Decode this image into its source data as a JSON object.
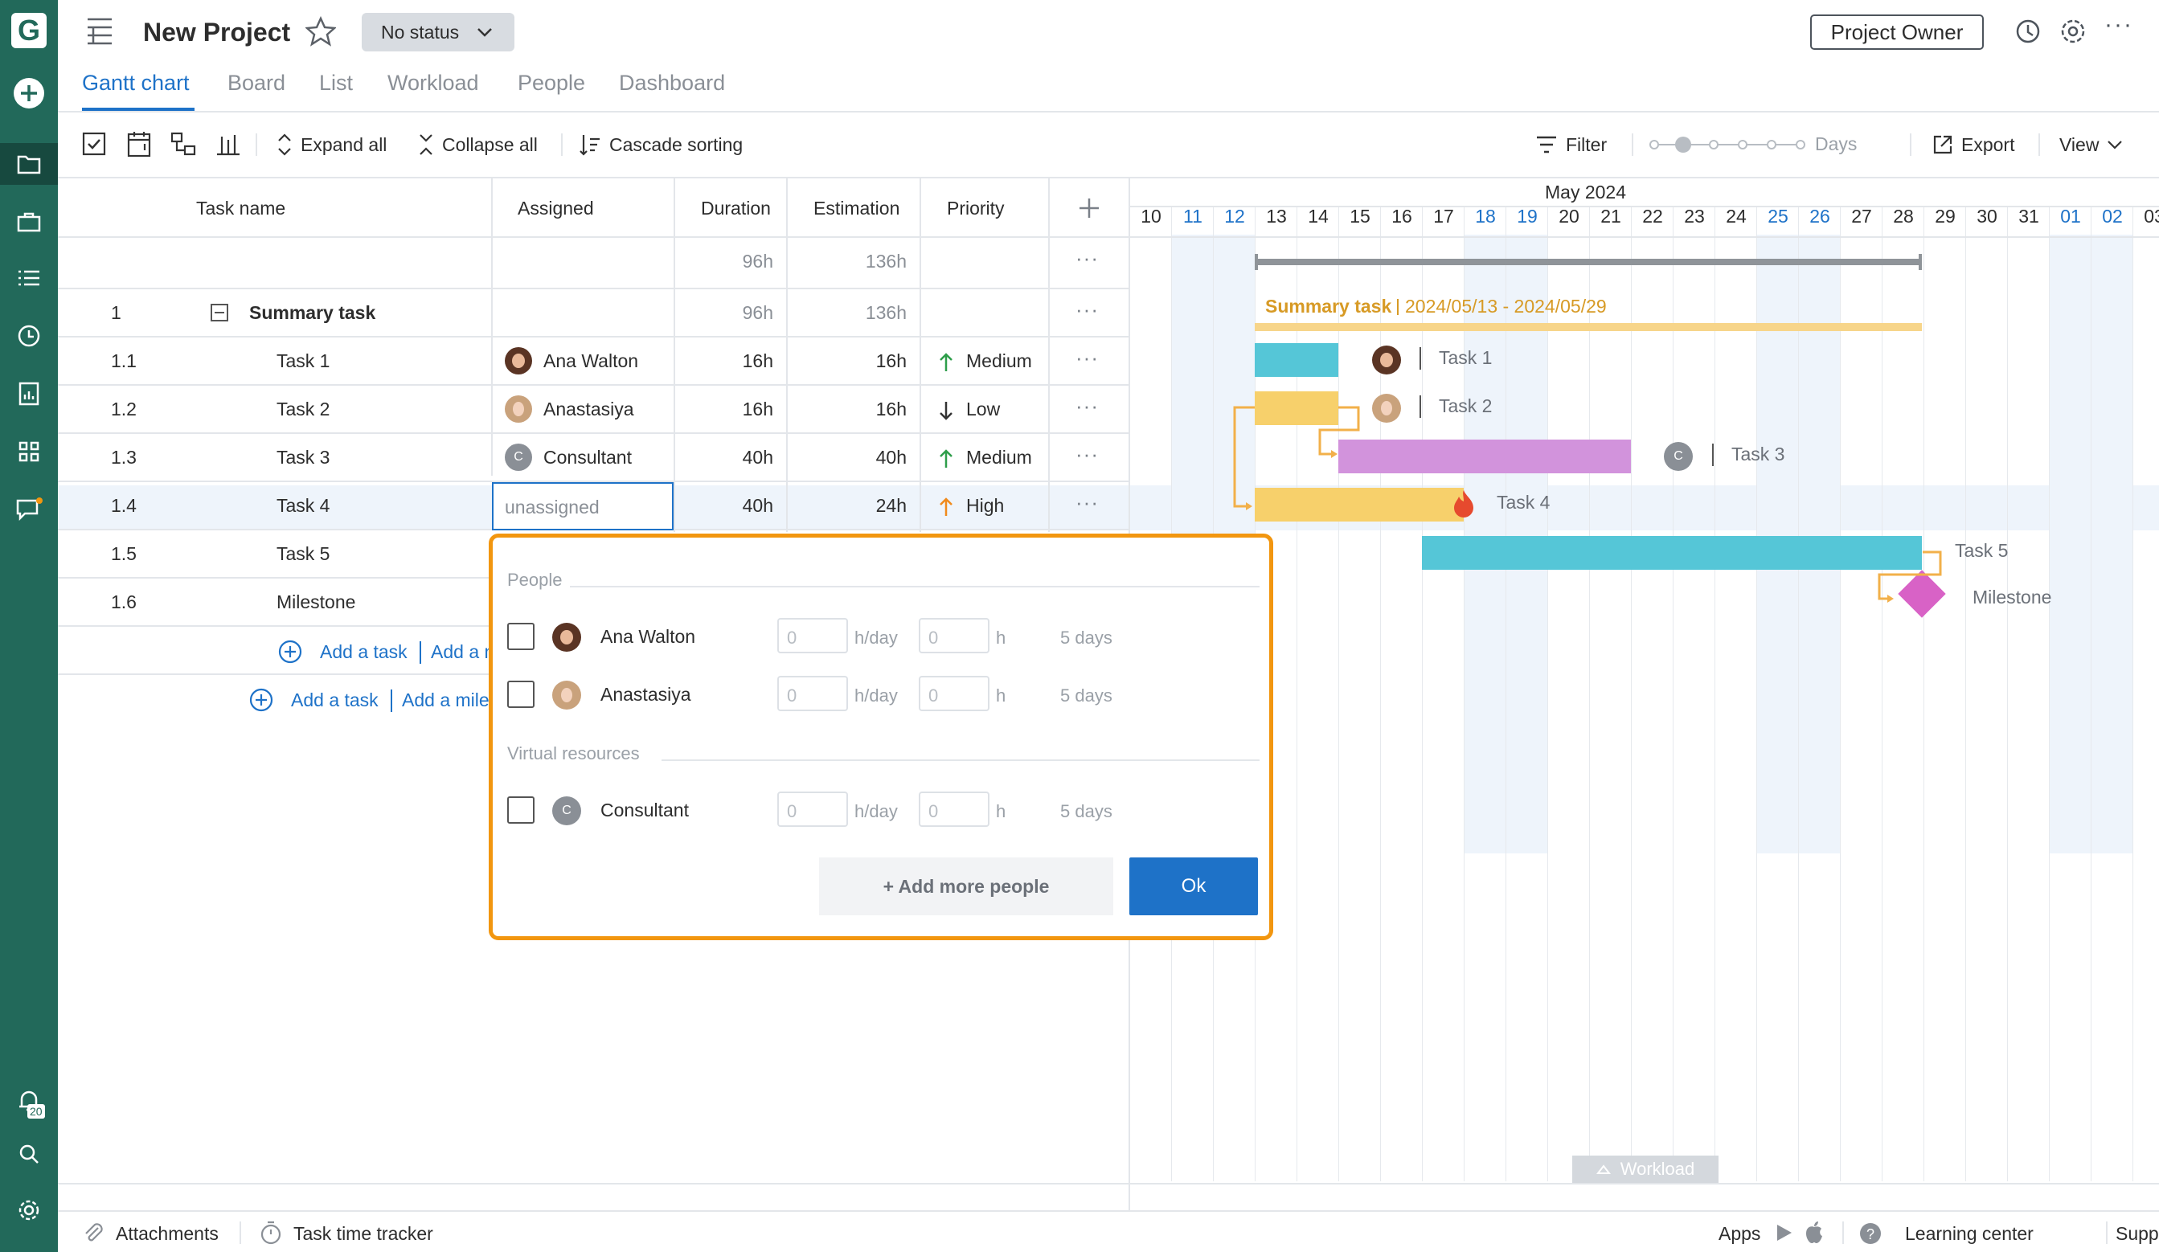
{
  "app": {
    "logo": "G"
  },
  "header": {
    "title": "New Project",
    "status": "No status",
    "owner_button": "Project Owner"
  },
  "tabs": [
    {
      "label": "Gantt chart",
      "active": true
    },
    {
      "label": "Board"
    },
    {
      "label": "List"
    },
    {
      "label": "Workload"
    },
    {
      "label": "People"
    },
    {
      "label": "Dashboard"
    }
  ],
  "toolbar": {
    "expand_all": "Expand all",
    "collapse_all": "Collapse all",
    "cascade_sorting": "Cascade sorting",
    "filter": "Filter",
    "zoom_unit": "Days",
    "export": "Export",
    "view": "View"
  },
  "grid": {
    "columns": [
      "Task name",
      "Assigned",
      "Duration",
      "Estimation",
      "Priority"
    ],
    "total": {
      "duration": "96h",
      "estimation": "136h"
    },
    "rows": [
      {
        "wbs": "1",
        "name": "Summary task",
        "assigned": "",
        "duration": "96h",
        "estimation": "136h",
        "priority": ""
      },
      {
        "wbs": "1.1",
        "name": "Task 1",
        "assigned": "Ana Walton",
        "duration": "16h",
        "estimation": "16h",
        "priority": "Medium"
      },
      {
        "wbs": "1.2",
        "name": "Task 2",
        "assigned": "Anastasiya",
        "duration": "16h",
        "estimation": "16h",
        "priority": "Low"
      },
      {
        "wbs": "1.3",
        "name": "Task 3",
        "assigned": "Consultant",
        "duration": "40h",
        "estimation": "40h",
        "priority": "Medium"
      },
      {
        "wbs": "1.4",
        "name": "Task 4",
        "assigned": "unassigned",
        "duration": "40h",
        "estimation": "24h",
        "priority": "High"
      },
      {
        "wbs": "1.5",
        "name": "Task 5"
      },
      {
        "wbs": "1.6",
        "name": "Milestone"
      }
    ],
    "add_task": "Add a task",
    "add_milestone": "Add a milestone",
    "add_milestone_short1": "Add a m",
    "add_milestone_short2": "Add a mile"
  },
  "timeline": {
    "month": "May 2024",
    "days": [
      "10",
      "11",
      "12",
      "13",
      "14",
      "15",
      "16",
      "17",
      "18",
      "19",
      "20",
      "21",
      "22",
      "23",
      "24",
      "25",
      "26",
      "27",
      "28",
      "29",
      "30",
      "31",
      "01",
      "02",
      "03"
    ],
    "weekend_days": [
      "11",
      "12",
      "18",
      "19",
      "25",
      "26",
      "01",
      "02"
    ],
    "summary_label": "Summary task",
    "summary_dates": "2024/05/13 - 2024/05/29",
    "bar_labels": [
      "Task 1",
      "Task 2",
      "Task 3",
      "Task 4",
      "Task 5",
      "Milestone"
    ],
    "consultant_initial": "C",
    "workload_tab": "Workload"
  },
  "popup": {
    "people_section": "People",
    "virtual_section": "Virtual resources",
    "people": [
      {
        "name": "Ana Walton",
        "hours_per_day": "0",
        "hours": "0",
        "duration": "5 days"
      },
      {
        "name": "Anastasiya",
        "hours_per_day": "0",
        "hours": "0",
        "duration": "5 days"
      }
    ],
    "virtual": [
      {
        "name": "Consultant",
        "initial": "C",
        "hours_per_day": "0",
        "hours": "0",
        "duration": "5 days"
      }
    ],
    "unit_hday": "h/day",
    "unit_h": "h",
    "add_more": "+ Add more people",
    "ok": "Ok"
  },
  "footer": {
    "attachments": "Attachments",
    "time_tracker": "Task time tracker",
    "apps": "Apps",
    "learning_center": "Learning center",
    "support": "Support"
  },
  "notifications_count": "20",
  "colors": {
    "sidebar": "#22695a",
    "accent": "#1e72c8",
    "popup_border": "#f2960f",
    "task_teal": "#55c6d7",
    "task_yellow": "#f7d06b",
    "task_purple": "#d293dc",
    "milestone": "#d862c6"
  }
}
